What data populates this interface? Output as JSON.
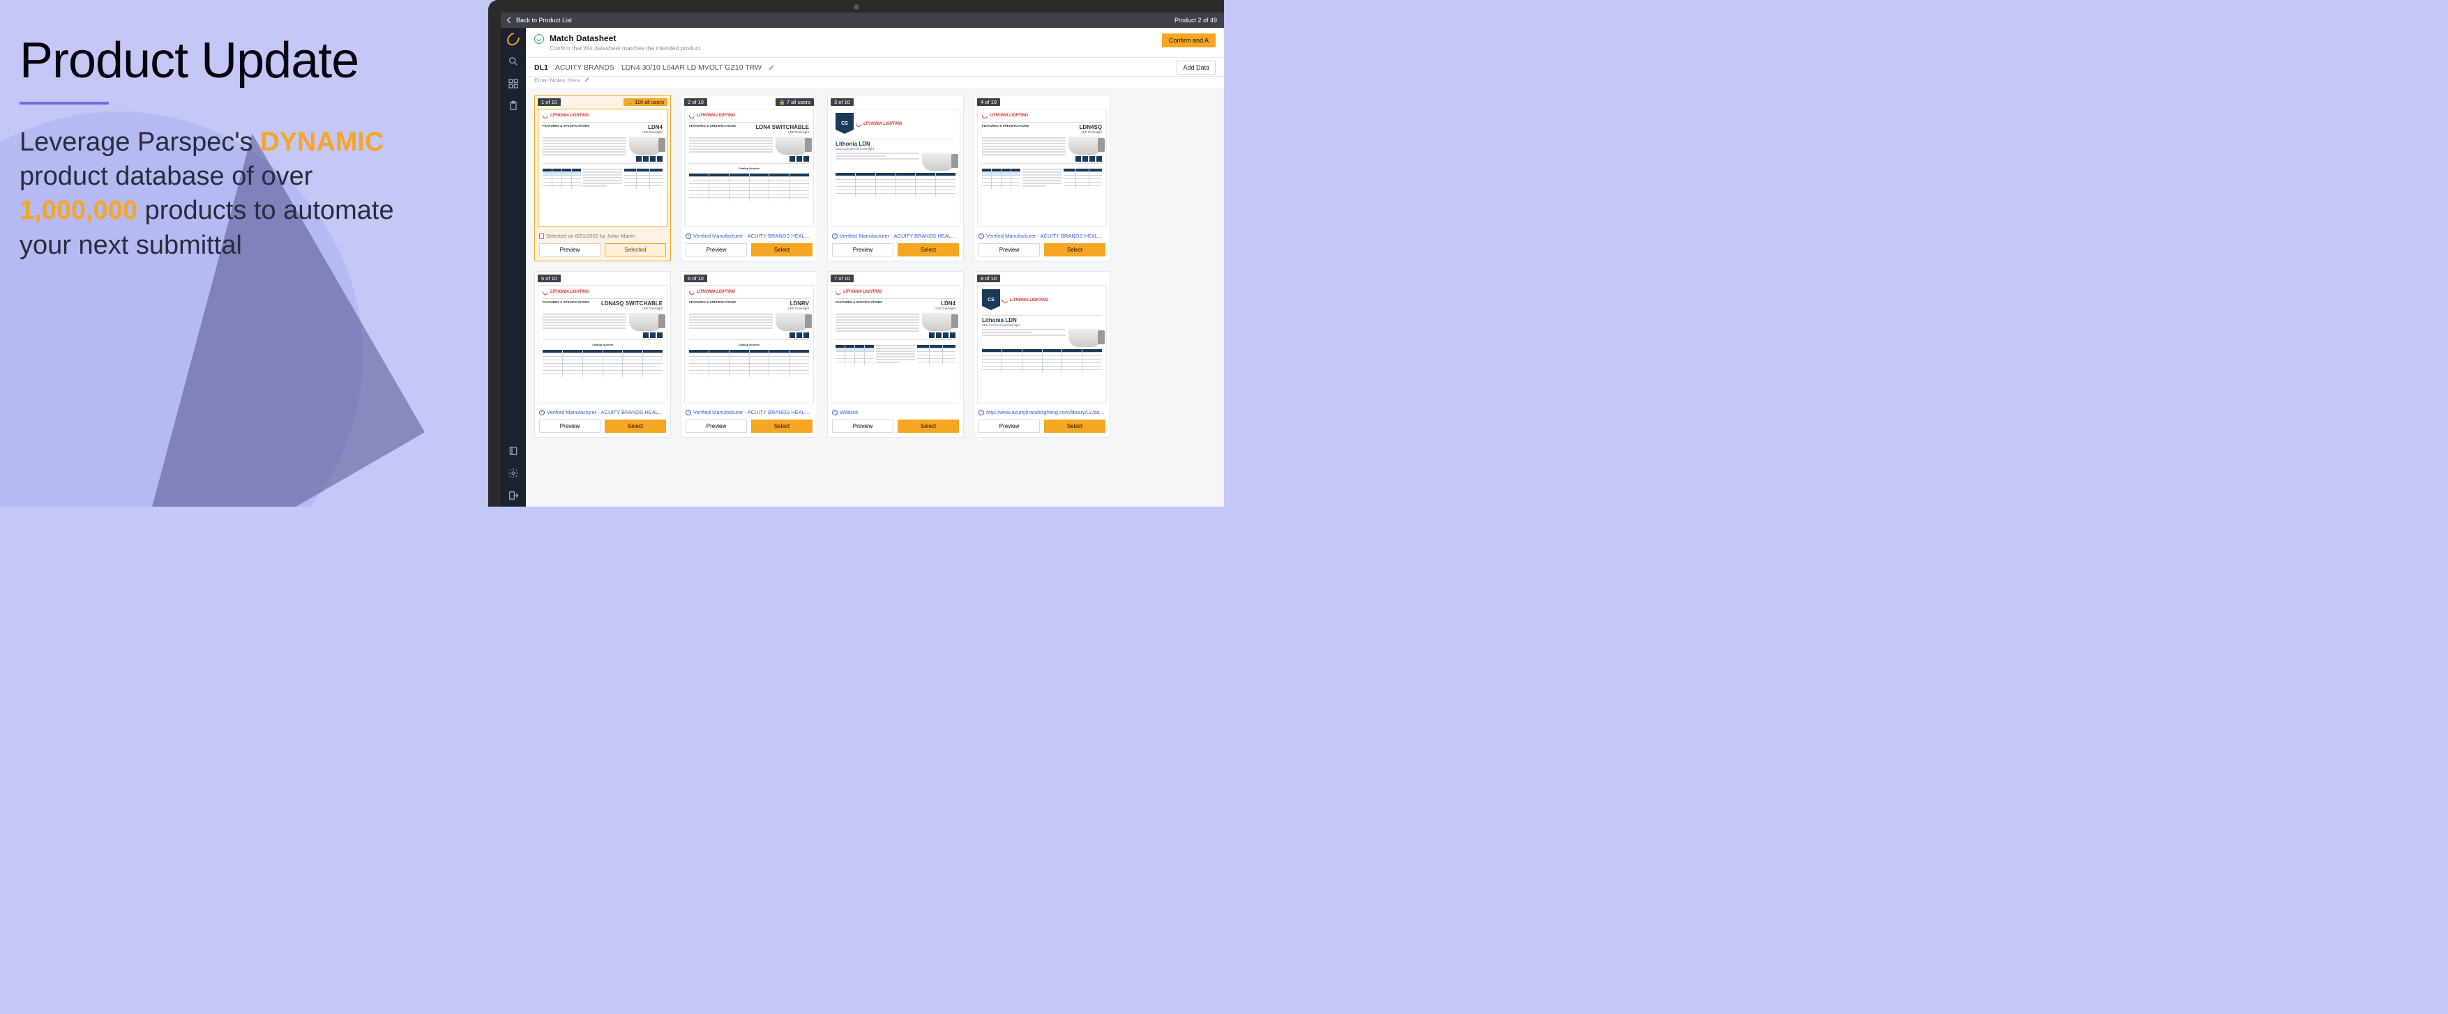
{
  "left": {
    "title": "Product Update",
    "subtitle_pre": "Leverage Parspec's ",
    "subtitle_hl1": "DYNAMIC",
    "subtitle_mid": " product database of over ",
    "subtitle_hl2": "1,000,000",
    "subtitle_post": " products to automate your next submittal"
  },
  "topbar": {
    "back_label": "Back to Product List",
    "counter": "Product 2 of 49"
  },
  "header": {
    "title": "Match Datasheet",
    "subtitle": "Confirm that this datasheet matches the intended product.",
    "confirm_label": "Confirm and A"
  },
  "crumbs": {
    "c1": "DL1",
    "c2": "ACUITY BRANDS",
    "c3": "LDN4 30/10 L04AR LD MVOLT GZ10 TRW",
    "add_label": "Add Data"
  },
  "notes_placeholder": "Enter Notes Here",
  "buttons": {
    "preview": "Preview",
    "select": "Select",
    "selected": "Selected"
  },
  "meta_labels": {
    "verified_mfg": "Verified Manufacturer - ACUITY BRANDS HEALTHCARE",
    "weblink": "Weblink",
    "url_long": "http://www.acuitybrandslighting.com/library/LL/document"
  },
  "pill_all_users": "all users",
  "cards": [
    {
      "index_label": "1 of 10",
      "extra_pill_prefix": "110 ",
      "extra_pill": "all users",
      "thumb_kind": "ldn4",
      "thumb_title": "LDN4",
      "meta_kind": "selected",
      "meta_text": "Selected on 8/31/2022 by Jolan Martin",
      "selected": true
    },
    {
      "index_label": "2 of 10",
      "extra_pill_prefix": "7 ",
      "extra_pill": "all users",
      "thumb_kind": "switchable",
      "thumb_title": "LDN4 SWITCHABLE",
      "meta_kind": "verified",
      "selected": false
    },
    {
      "index_label": "3 of 10",
      "thumb_kind": "lithonia_ldn",
      "thumb_title": "Lithonia LDN",
      "meta_kind": "verified",
      "selected": false
    },
    {
      "index_label": "4 of 10",
      "thumb_kind": "ldn4sq",
      "thumb_title": "LDN4SQ",
      "meta_kind": "verified",
      "selected": false
    },
    {
      "index_label": "5 of 10",
      "thumb_kind": "switchable",
      "thumb_title": "LDN4SQ SWITCHABLE",
      "meta_kind": "verified",
      "selected": false
    },
    {
      "index_label": "6 of 10",
      "thumb_kind": "ldnrv",
      "thumb_title": "LDNRV",
      "meta_kind": "verified",
      "selected": false
    },
    {
      "index_label": "7 of 10",
      "thumb_kind": "ldn4",
      "thumb_title": "LDN4",
      "meta_kind": "weblink",
      "selected": false
    },
    {
      "index_label": "8 of 10",
      "thumb_kind": "lithonia_ldn",
      "thumb_title": "Lithonia LDN",
      "meta_kind": "url",
      "selected": false
    }
  ]
}
